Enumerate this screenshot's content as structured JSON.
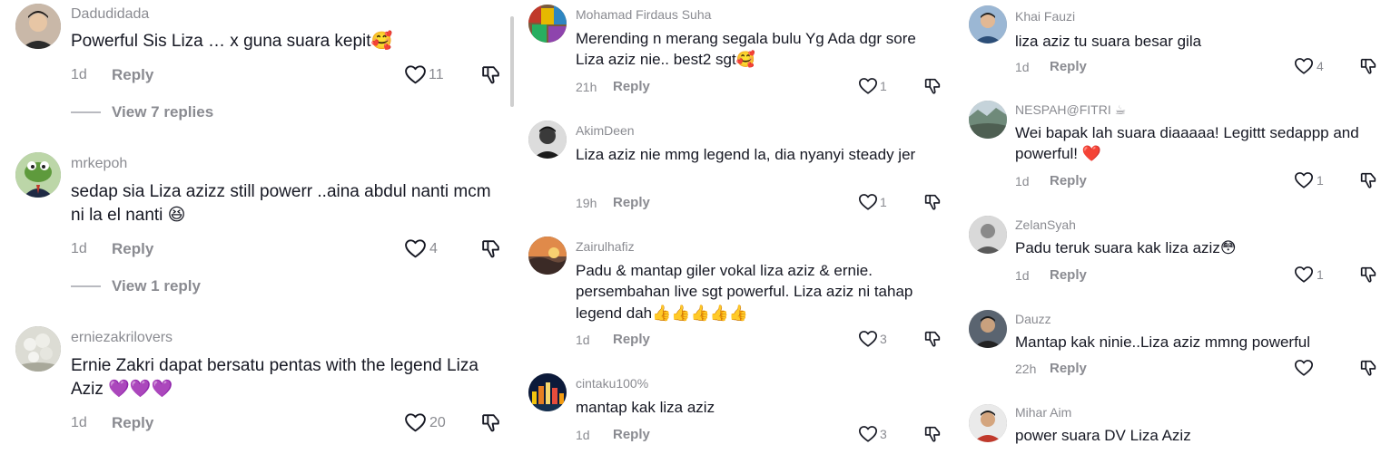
{
  "colors": {
    "text": "#161823",
    "muted": "#8a8b91",
    "heart_emoji": "#e0245e",
    "purple_heart": "#9b4de0"
  },
  "panels": [
    {
      "comments": [
        {
          "username": "Dadudidada",
          "text": "Powerful Sis Liza … x guna suara kepit🥰",
          "time": "1d",
          "reply": "Reply",
          "likes": "11",
          "view_replies": "View 7 replies",
          "avatar": "man-portrait"
        },
        {
          "username": "mrkepoh",
          "text": "sedap sia Liza azizz still powerr ..aina abdul nanti mcm ni la el nanti 😆",
          "time": "1d",
          "reply": "Reply",
          "likes": "4",
          "view_replies": "View 1 reply",
          "avatar": "frog-suit"
        },
        {
          "username": "erniezakrilovers",
          "text": "Ernie Zakri dapat bersatu pentas with the legend Liza Aziz 💜💜💜",
          "time": "1d",
          "reply": "Reply",
          "likes": "20",
          "view_replies": "",
          "avatar": "flowers"
        }
      ]
    },
    {
      "comments": [
        {
          "username": "Mohamad Firdaus Suha",
          "text": "Merending n merang segala bulu Yg Ada dgr sore Liza aziz nie.. best2 sgt🥰",
          "time": "21h",
          "reply": "Reply",
          "likes": "1",
          "avatar": "colorful"
        },
        {
          "username": "AkimDeen",
          "text": "Liza aziz nie mmg legend la, dia nyanyi steady jer",
          "time": "19h",
          "reply": "Reply",
          "likes": "1",
          "avatar": "bw-portrait"
        },
        {
          "username": "Zairulhafiz",
          "text": "Padu & mantap giler vokal liza aziz & ernie. persembahan live sgt powerful. Liza aziz ni tahap legend dah👍👍👍👍👍",
          "time": "1d",
          "reply": "Reply",
          "likes": "3",
          "avatar": "sunset"
        },
        {
          "username": "cintaku100%",
          "text": "mantap kak liza aziz",
          "time": "1d",
          "reply": "Reply",
          "likes": "3",
          "avatar": "city-night"
        }
      ]
    },
    {
      "comments": [
        {
          "username": "Khai Fauzi",
          "text": "liza aziz tu suara besar gila",
          "time": "1d",
          "reply": "Reply",
          "likes": "4",
          "avatar": "man-blue"
        },
        {
          "username": "NESPAH@FITRI ☕",
          "text": "Wei bapak lah suara diaaaaa! Legittt sedappp and powerful! ❤️",
          "time": "1d",
          "reply": "Reply",
          "likes": "1",
          "avatar": "landscape"
        },
        {
          "username": "ZelanSyah",
          "text": "Padu teruk suara kak liza aziz😳",
          "time": "1d",
          "reply": "Reply",
          "likes": "1",
          "avatar": "man-grey"
        },
        {
          "username": "Dauzz",
          "text": "Mantap kak ninie..Liza aziz mmng powerful",
          "time": "22h",
          "reply": "Reply",
          "likes": "",
          "avatar": "man-dark"
        },
        {
          "username": "Mihar Aim",
          "text": "power suara DV Liza Aziz",
          "time": "",
          "reply": "",
          "likes": "",
          "avatar": "man-red"
        }
      ]
    }
  ]
}
